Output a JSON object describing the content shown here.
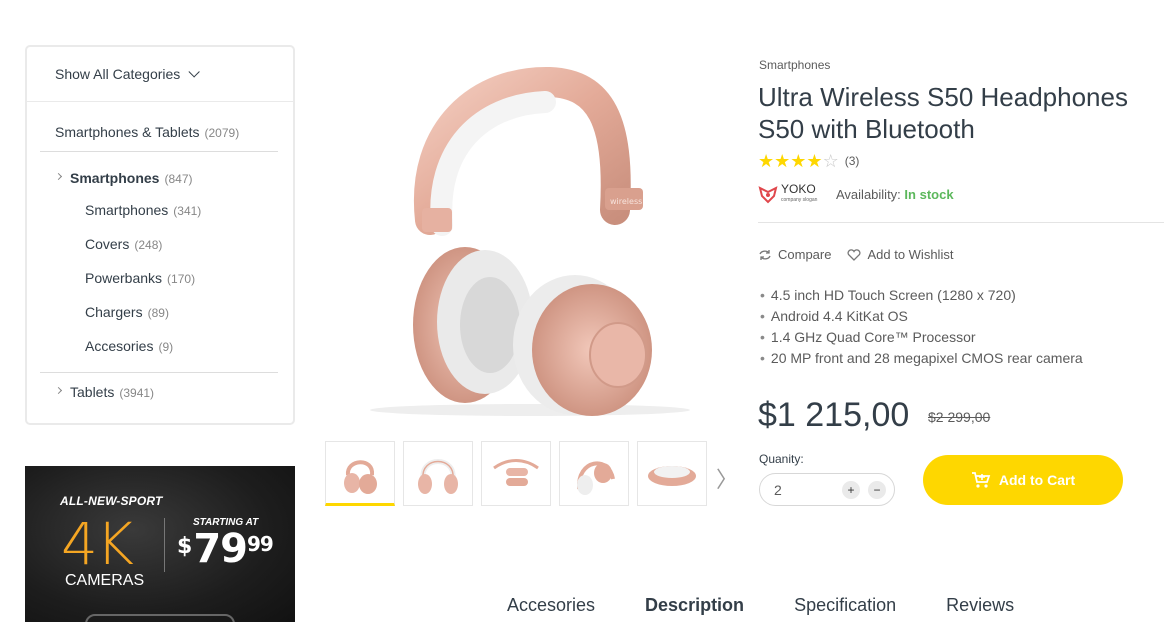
{
  "sidebar": {
    "header": "Show All Categories",
    "top_category": {
      "label": "Smartphones & Tablets",
      "count": "(2079)"
    },
    "parent": {
      "label": "Smartphones",
      "count": "(847)"
    },
    "children": [
      {
        "label": "Smartphones",
        "count": "(341)"
      },
      {
        "label": "Covers",
        "count": "(248)"
      },
      {
        "label": "Powerbanks",
        "count": "(170)"
      },
      {
        "label": "Chargers",
        "count": "(89)"
      },
      {
        "label": "Accesories",
        "count": "(9)"
      }
    ],
    "sibling": {
      "label": "Tablets",
      "count": "(3941)"
    }
  },
  "banner": {
    "tagline": "ALL-NEW-SPORT",
    "big": "4K",
    "product": "CAMERAS",
    "starting": "STARTING AT",
    "currency": "$",
    "price_main": "79",
    "price_cents": "99"
  },
  "product": {
    "category": "Smartphones",
    "title": "Ultra Wireless S50 Headphones S50 with Bluetooth",
    "rating": 4,
    "rating_max": 5,
    "review_count": "(3)",
    "brand": "YOKO",
    "brand_slogan": "company slogan",
    "availability_label": "Availability:",
    "availability_value": "In stock",
    "compare_label": "Compare",
    "wishlist_label": "Add to Wishlist",
    "features": [
      "4.5 inch HD Touch Screen (1280 x 720)",
      "Android 4.4 KitKat OS",
      "1.4 GHz Quad Core™ Processor",
      "20 MP front and 28 megapixel CMOS rear camera"
    ],
    "price": "$1 215,00",
    "old_price": "$2 299,00",
    "quantity_label": "Quanity:",
    "quantity_value": "2",
    "add_to_cart": "Add to Cart",
    "headphone_brand_text": "wireless"
  },
  "tabs": [
    "Accesories",
    "Description",
    "Specification",
    "Reviews"
  ],
  "active_tab": "Description",
  "colors": {
    "accent": "#fed700",
    "stock": "#5cb85c",
    "banner_accent": "#f5a623",
    "rose": "#e8b5a6"
  }
}
